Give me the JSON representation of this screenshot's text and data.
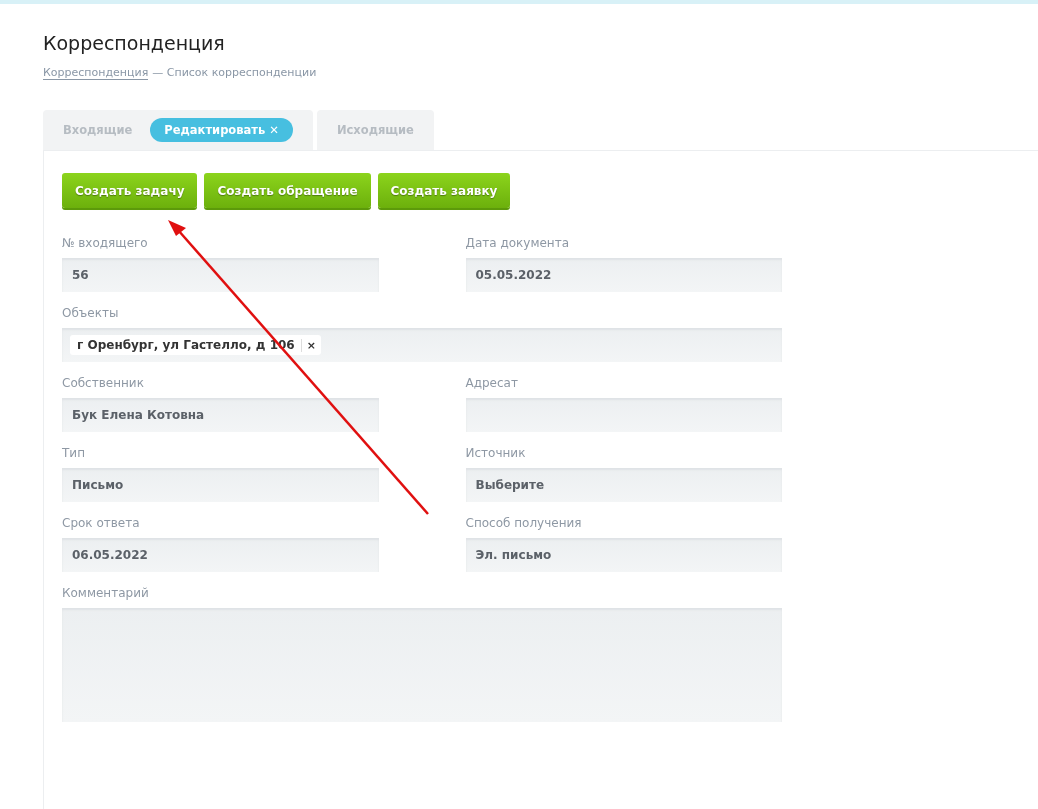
{
  "page": {
    "title": "Корреспонденция"
  },
  "breadcrumb": {
    "link": "Корреспонденция",
    "separator": "—",
    "current": "Список корреспонденции"
  },
  "tabs": [
    {
      "label": "Входящие",
      "selected": false,
      "chip": {
        "label": "Редактировать",
        "close": "✕"
      }
    },
    {
      "label": "Исходящие",
      "selected": false
    }
  ],
  "buttons": [
    "Создать задачу",
    "Создать обращение",
    "Создать заявку"
  ],
  "rows": [
    {
      "fields": [
        {
          "kind": "text",
          "label": "№ входящего",
          "value": "56"
        },
        {
          "kind": "text",
          "label": "Дата документа",
          "value": "05.05.2022"
        }
      ]
    },
    {
      "fields": [
        {
          "kind": "tags",
          "label": "Объекты",
          "tags": [
            {
              "label": "г Оренбург, ул Гастелло, д 106",
              "remove": "×"
            }
          ]
        }
      ]
    },
    {
      "fields": [
        {
          "kind": "text",
          "label": "Собственник",
          "value": "Бук Елена Котовна"
        },
        {
          "kind": "text",
          "label": "Адресат"
        }
      ]
    },
    {
      "fields": [
        {
          "kind": "text",
          "label": "Тип",
          "value": "Письмо"
        },
        {
          "kind": "text",
          "label": "Источник",
          "value": "Выберите"
        }
      ]
    },
    {
      "fields": [
        {
          "kind": "text",
          "label": "Срок ответа",
          "value": "06.05.2022"
        },
        {
          "kind": "text",
          "label": "Способ получения",
          "value": "Эл. письмо"
        }
      ]
    },
    {
      "fields": [
        {
          "kind": "textarea",
          "label": "Комментарий"
        }
      ]
    }
  ],
  "annotation": {
    "kind": "arrow"
  }
}
